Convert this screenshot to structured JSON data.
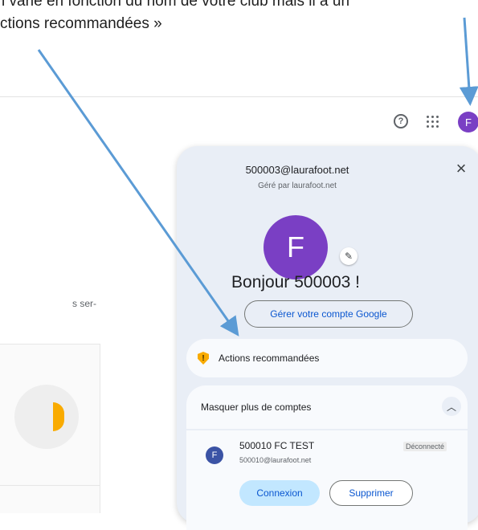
{
  "caption": {
    "line1": "i varie en fonction du nom de votre club mais il a un",
    "line2": "ctions recommandées »"
  },
  "page": {
    "side_text": "s ser-"
  },
  "topbar": {
    "help_icon": "help-circle-icon",
    "apps_icon": "apps-grid-icon",
    "avatar_letter": "F"
  },
  "account_panel": {
    "email": "500003@laurafoot.net",
    "managed_by": "Géré par laurafoot.net",
    "avatar_letter": "F",
    "greeting": "Bonjour 500003 !",
    "manage_button": "Gérer votre compte Google",
    "recommended_actions": "Actions recommandées",
    "more_accounts_toggle": "Masquer plus de comptes",
    "accounts": [
      {
        "avatar_letter": "F",
        "name": "500010 FC TEST",
        "email": "500010@laurafoot.net",
        "status": "Déconnecté",
        "connect_label": "Connexion",
        "delete_label": "Supprimer"
      }
    ]
  },
  "colors": {
    "arrow": "#5b9bd5",
    "avatar": "#7a3fc4",
    "panel_bg": "#e9eef6",
    "accent_blue": "#0b57d0",
    "warning_yellow": "#f9ab00"
  }
}
